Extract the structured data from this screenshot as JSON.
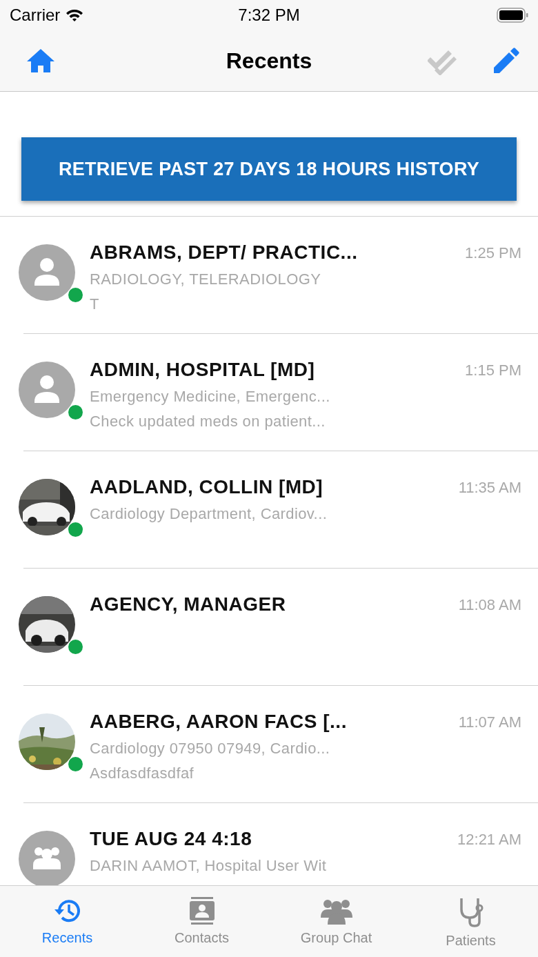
{
  "status_bar": {
    "carrier": "Carrier",
    "time": "7:32 PM"
  },
  "nav_bar": {
    "title": "Recents"
  },
  "retrieve_button": {
    "label": "RETRIEVE PAST 27 DAYS 18 HOURS HISTORY"
  },
  "conversations": [
    {
      "kind": "person",
      "online": true,
      "name": "ABRAMS, DEPT/ PRACTIC...",
      "subtitle": "RADIOLOGY,  TELERADIOLOGY",
      "preview": "T",
      "time": "1:25 PM"
    },
    {
      "kind": "person",
      "online": true,
      "name": "ADMIN, HOSPITAL [MD]",
      "subtitle": "Emergency Medicine,  Emergenc...",
      "preview": "Check updated meds on patient...",
      "time": "1:15 PM"
    },
    {
      "kind": "picture",
      "online": true,
      "name": "AADLAND, COLLIN [MD]",
      "subtitle": "Cardiology Department,  Cardiov...",
      "time": "11:35 AM"
    },
    {
      "kind": "picture",
      "online": true,
      "name": "AGENCY, MANAGER",
      "time": "11:08 AM"
    },
    {
      "kind": "picture",
      "online": true,
      "name": "AABERG, AARON FACS [...",
      "subtitle": "Cardiology 07950 07949,  Cardio...",
      "preview": "Asdfasdfasdfaf",
      "time": "11:07 AM"
    },
    {
      "kind": "group",
      "online": false,
      "name": "TUE AUG 24 4:18",
      "subtitle": "DARIN AAMOT, Hospital User Wit",
      "time": "12:21 AM"
    }
  ],
  "tab_bar": [
    {
      "kind": "recents",
      "label": "Recents",
      "selected": true
    },
    {
      "kind": "contacts",
      "label": "Contacts",
      "selected": false
    },
    {
      "kind": "group",
      "label": "Group Chat",
      "selected": false
    },
    {
      "kind": "patients",
      "label": "Patients",
      "selected": false
    }
  ]
}
